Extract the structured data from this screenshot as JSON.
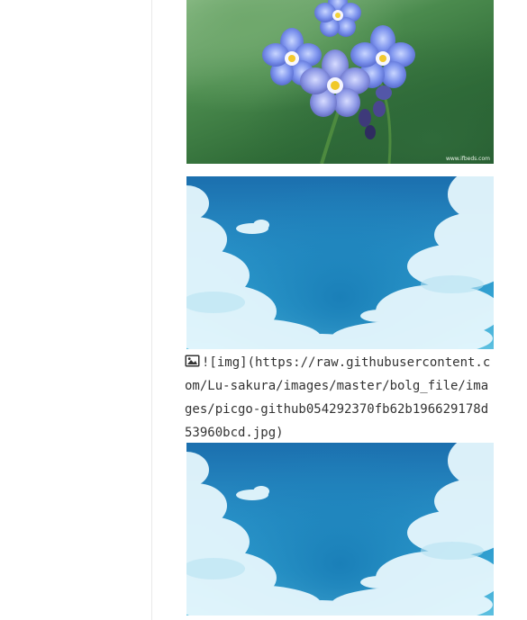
{
  "flower_image": {
    "watermark": "www.ifbeds.com"
  },
  "broken_image": {
    "icon": "image-icon",
    "markdown_text": "![img](https://raw.githubusercontent.com/Lu-sakura/images/master/bolg_file/images/picgo-github054292370fb62b196629178d53960bcd.jpg)"
  },
  "colors": {
    "sidebar_border": "#e9e9e9",
    "text": "#333333",
    "sky_top": "#1b6fae",
    "sky_bottom": "#5dc0e0"
  }
}
